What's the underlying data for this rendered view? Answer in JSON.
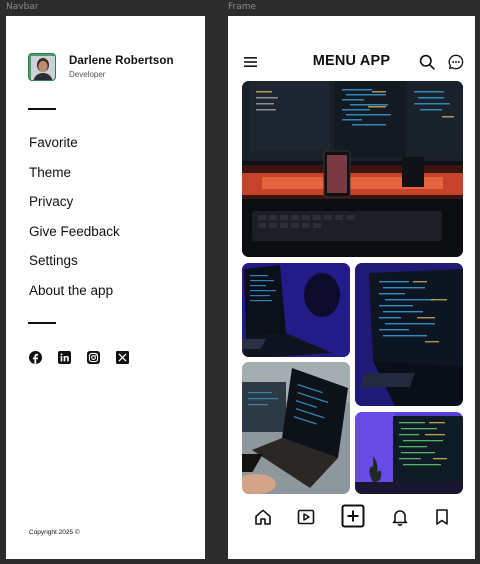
{
  "labels": {
    "navbar": "Navbar",
    "frame": "Frame"
  },
  "profile": {
    "name": "Darlene Robertson",
    "role": "Developer"
  },
  "menu": {
    "items": [
      "Favorite",
      "Theme",
      "Privacy",
      "Give Feedback",
      "Settings",
      "About the app"
    ]
  },
  "socials": {
    "icons": [
      "facebook-icon",
      "linkedin-icon",
      "instagram-icon",
      "x-icon"
    ]
  },
  "footer": {
    "copyright": "Copyright 2025 ©"
  },
  "app": {
    "title": "MENU APP"
  },
  "bottom_nav": {
    "icons": [
      "home-icon",
      "video-icon",
      "add-icon",
      "bell-icon",
      "bookmark-icon"
    ]
  },
  "colors": {
    "accent": "#111111",
    "panel_bg": "#ffffff",
    "canvas_bg": "#2c2c2c"
  }
}
